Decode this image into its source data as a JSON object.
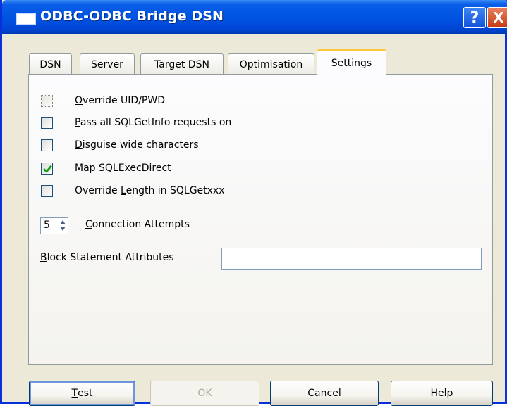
{
  "window": {
    "title": "ODBC-ODBC Bridge DSN",
    "help_label": "?",
    "close_label": "X"
  },
  "tabs": [
    {
      "label": "DSN"
    },
    {
      "label": "Server"
    },
    {
      "label": "Target DSN"
    },
    {
      "label": "Optimisation"
    },
    {
      "label": "Settings",
      "active": true
    }
  ],
  "settings": {
    "checkboxes": [
      {
        "mnemonic": "O",
        "rest": "verride UID/PWD",
        "checked": false
      },
      {
        "mnemonic": "P",
        "rest": "ass all SQLGetInfo requests on",
        "checked": false
      },
      {
        "mnemonic": "D",
        "rest": "isguise wide characters",
        "checked": false
      },
      {
        "mnemonic": "M",
        "rest": "ap SQLExecDirect",
        "checked": true
      },
      {
        "pre": "Override ",
        "mnemonic": "L",
        "rest": "ength in SQLGetxxx",
        "checked": false
      }
    ],
    "connection_attempts": {
      "value": "5",
      "mnemonic": "C",
      "rest": "onnection Attempts"
    },
    "block_statement": {
      "mnemonic": "B",
      "rest": "lock Statement Attributes",
      "value": ""
    }
  },
  "buttons": {
    "test": {
      "mnemonic": "T",
      "rest": "est"
    },
    "ok": "OK",
    "cancel": "Cancel",
    "help": "Help"
  }
}
